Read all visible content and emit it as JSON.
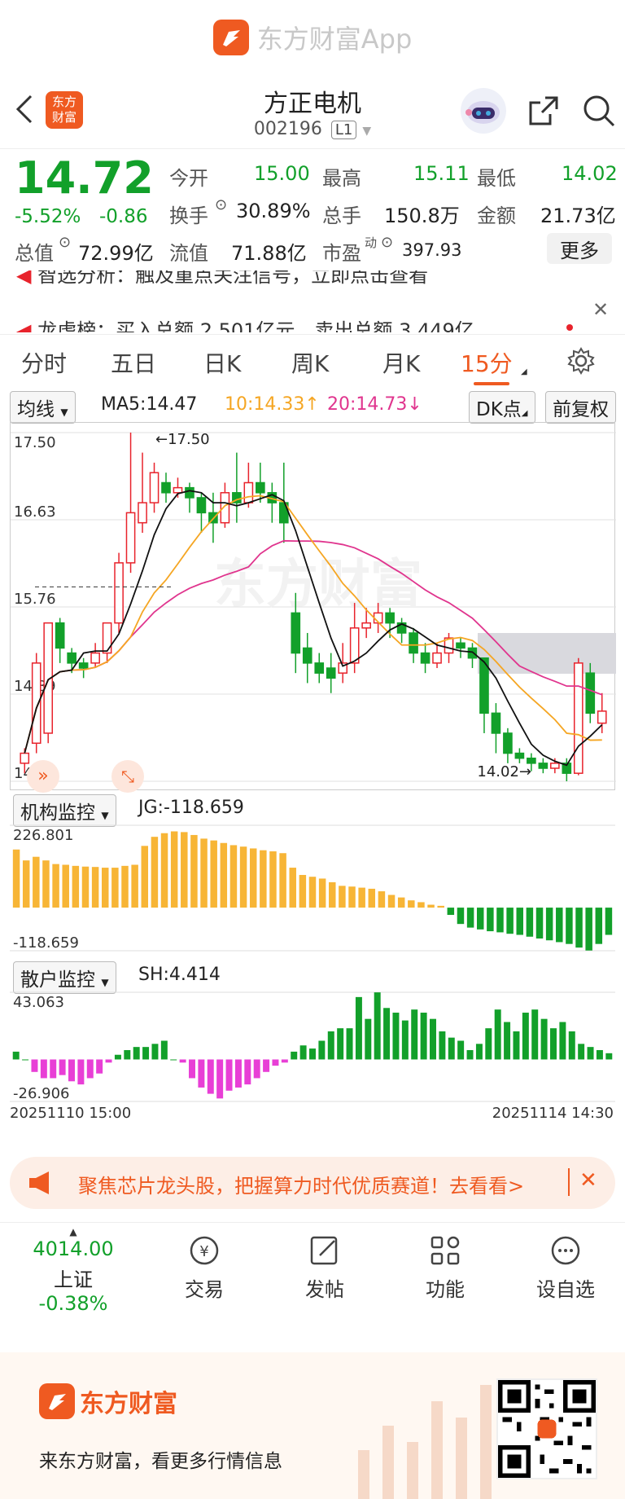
{
  "app_banner": {
    "name": "东方财富App"
  },
  "header": {
    "title": "方正电机",
    "code": "002196",
    "level": "L1"
  },
  "quote": {
    "price": "14.72",
    "change_pct": "-5.52%",
    "change": "-0.86",
    "open_label": "今开",
    "open": "15.00",
    "high_label": "最高",
    "high": "15.11",
    "low_label": "最低",
    "low": "14.02",
    "turnover_label": "换手",
    "turnover": "30.89%",
    "volume_label": "总手",
    "volume": "150.8万",
    "amount_label": "金额",
    "amount": "21.73亿",
    "mktcap_label": "总值",
    "mktcap": "72.99亿",
    "float_label": "流值",
    "float": "71.88亿",
    "pe_label": "市盈",
    "pe_sup": "动",
    "pe": "397.93",
    "more": "更多"
  },
  "news": {
    "line1": "智选分析：触及重点关注信号，立即点击查看",
    "line2": "龙虎榜：买入总额 2.501亿元，卖出总额 3.449亿"
  },
  "tabs": [
    "分时",
    "五日",
    "日K",
    "周K",
    "月K",
    "15分"
  ],
  "active_tab": "15分",
  "ma_row": {
    "select": "均线",
    "ma5": "MA5:14.47",
    "ma10": "10:14.33",
    "ma20": "20:14.73",
    "dk": "DK点",
    "fq": "前复权"
  },
  "chart_data": [
    {
      "type": "candlestick",
      "title": "",
      "y_ticks": [
        "17.50",
        "16.63",
        "15.76",
        "14.89",
        "14.02"
      ],
      "ylim": [
        14.02,
        17.5
      ],
      "annotations": [
        "17.50",
        "14.02"
      ],
      "watermark": "东方财富",
      "colors": {
        "up": "#e8232c",
        "down": "#12a02a",
        "ma5": "#111111",
        "ma10": "#f5a623",
        "ma20": "#e0358e"
      },
      "candles": [
        [
          14.2,
          14.3,
          14.1,
          14.35
        ],
        [
          14.4,
          15.2,
          14.3,
          15.3
        ],
        [
          14.5,
          15.6,
          14.4,
          15.6
        ],
        [
          15.6,
          15.35,
          15.2,
          15.65
        ],
        [
          15.3,
          15.2,
          15.1,
          15.35
        ],
        [
          15.2,
          15.15,
          15.05,
          15.25
        ],
        [
          15.2,
          15.3,
          15.15,
          15.4
        ],
        [
          15.3,
          15.6,
          15.2,
          15.6
        ],
        [
          15.6,
          16.2,
          15.5,
          16.3
        ],
        [
          16.2,
          16.7,
          16.1,
          17.5
        ],
        [
          16.6,
          16.8,
          16.5,
          17.3
        ],
        [
          16.8,
          17.1,
          16.7,
          17.2
        ],
        [
          17.0,
          16.9,
          16.8,
          17.1
        ],
        [
          16.9,
          16.95,
          16.85,
          17.05
        ],
        [
          16.95,
          16.85,
          16.7,
          17.0
        ],
        [
          16.85,
          16.7,
          16.5,
          16.9
        ],
        [
          16.7,
          16.6,
          16.4,
          16.9
        ],
        [
          16.6,
          16.9,
          16.55,
          17.0
        ],
        [
          16.9,
          16.8,
          16.6,
          17.3
        ],
        [
          16.8,
          17.0,
          16.75,
          17.2
        ],
        [
          17.0,
          16.9,
          16.8,
          17.2
        ],
        [
          16.9,
          16.8,
          16.6,
          17.0
        ],
        [
          16.8,
          16.6,
          16.4,
          17.2
        ],
        [
          15.7,
          15.3,
          15.1,
          15.9
        ],
        [
          15.35,
          15.2,
          15.0,
          15.5
        ],
        [
          15.2,
          15.1,
          15.0,
          15.3
        ],
        [
          15.15,
          15.05,
          14.9,
          15.3
        ],
        [
          15.1,
          15.2,
          15.0,
          15.4
        ],
        [
          15.2,
          15.55,
          15.1,
          15.8
        ],
        [
          15.55,
          15.6,
          15.45,
          15.75
        ],
        [
          15.6,
          15.7,
          15.5,
          15.8
        ],
        [
          15.7,
          15.6,
          15.45,
          15.75
        ],
        [
          15.6,
          15.5,
          15.4,
          15.65
        ],
        [
          15.5,
          15.3,
          15.2,
          15.55
        ],
        [
          15.3,
          15.2,
          15.1,
          15.4
        ],
        [
          15.2,
          15.3,
          15.15,
          15.4
        ],
        [
          15.3,
          15.45,
          15.2,
          15.5
        ],
        [
          15.4,
          15.35,
          15.25,
          15.45
        ],
        [
          15.35,
          15.25,
          15.15,
          15.4
        ],
        [
          15.25,
          14.7,
          14.5,
          15.1
        ],
        [
          14.7,
          14.5,
          14.3,
          14.8
        ],
        [
          14.5,
          14.3,
          14.2,
          14.55
        ],
        [
          14.3,
          14.25,
          14.2,
          14.35
        ],
        [
          14.25,
          14.2,
          14.12,
          14.3
        ],
        [
          14.2,
          14.15,
          14.1,
          14.25
        ],
        [
          14.15,
          14.2,
          14.1,
          14.25
        ],
        [
          14.2,
          14.1,
          14.02,
          14.25
        ],
        [
          14.1,
          15.2,
          14.08,
          15.25
        ],
        [
          15.1,
          14.7,
          14.6,
          15.2
        ],
        [
          14.6,
          14.72,
          14.5,
          14.9
        ]
      ]
    },
    {
      "type": "bar",
      "title": "机构监控",
      "value_label": "JG:-118.659",
      "y_ticks": [
        "226.801",
        "-118.659"
      ],
      "ylim": [
        -118.659,
        226.801
      ],
      "values": [
        160,
        130,
        140,
        130,
        120,
        118,
        115,
        113,
        112,
        110,
        110,
        115,
        118,
        170,
        195,
        205,
        210,
        208,
        200,
        190,
        185,
        178,
        172,
        168,
        163,
        158,
        155,
        150,
        110,
        90,
        85,
        80,
        70,
        60,
        58,
        55,
        52,
        45,
        35,
        28,
        20,
        15,
        8,
        5,
        -20,
        -45,
        -55,
        -60,
        -65,
        -68,
        -72,
        -75,
        -80,
        -85,
        -90,
        -95,
        -100,
        -110,
        -118,
        -100,
        -75
      ]
    },
    {
      "type": "bar",
      "title": "散户监控",
      "value_label": "SH:4.414",
      "y_ticks": [
        "43.063",
        "-26.906"
      ],
      "ylim": [
        -26.906,
        43.063
      ],
      "x_labels": [
        "20251110 15:00",
        "20251114 14:30"
      ],
      "values": [
        5,
        0,
        -8,
        -12,
        -12,
        -10,
        -14,
        -16,
        -12,
        -9,
        -2,
        3,
        6,
        8,
        8,
        10,
        12,
        0,
        -2,
        -12,
        -18,
        -22,
        -25,
        -20,
        -18,
        -16,
        -12,
        -8,
        -4,
        -2,
        5,
        9,
        7,
        12,
        18,
        20,
        20,
        40,
        26,
        43,
        33,
        30,
        25,
        32,
        30,
        26,
        18,
        14,
        12,
        6,
        10,
        20,
        32,
        24,
        18,
        30,
        32,
        26,
        20,
        24,
        18,
        10,
        8,
        6,
        4
      ]
    }
  ],
  "ad": {
    "text": "聚焦芯片龙头股，把握算力时代优质赛道！去看看>"
  },
  "tabbar": {
    "index_value": "4014.00",
    "index_name": "上证",
    "index_change": "-0.38%",
    "items": [
      "交易",
      "发帖",
      "功能",
      "设自选"
    ]
  },
  "footer": {
    "brand": "东方财富",
    "slogan": "来东方财富，看更多行情信息"
  }
}
